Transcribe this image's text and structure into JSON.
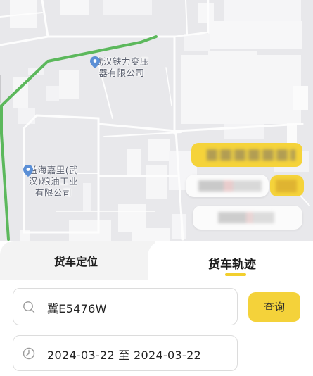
{
  "map": {
    "poi_1_line1": "武汉铁力变压",
    "poi_1_line2": "器有限公司",
    "poi_2_line1": "益海嘉里(武",
    "poi_2_line2": "汉)粮油工业",
    "poi_2_line3": "有限公司",
    "route_color": "#5cb85c",
    "pin_color": "#5b8fd6"
  },
  "tabs": {
    "left_label": "货车定位",
    "right_label": "货车轨迹",
    "active": "货车轨迹",
    "accent_color": "#f2cf2e"
  },
  "search": {
    "plate_value": "冀E5476W",
    "query_label": "查询",
    "date_range": "2024-03-22 至 2024-03-22"
  },
  "icons": {
    "search": "search-icon",
    "clock": "clock-icon",
    "map_pin": "location-pin-icon"
  }
}
